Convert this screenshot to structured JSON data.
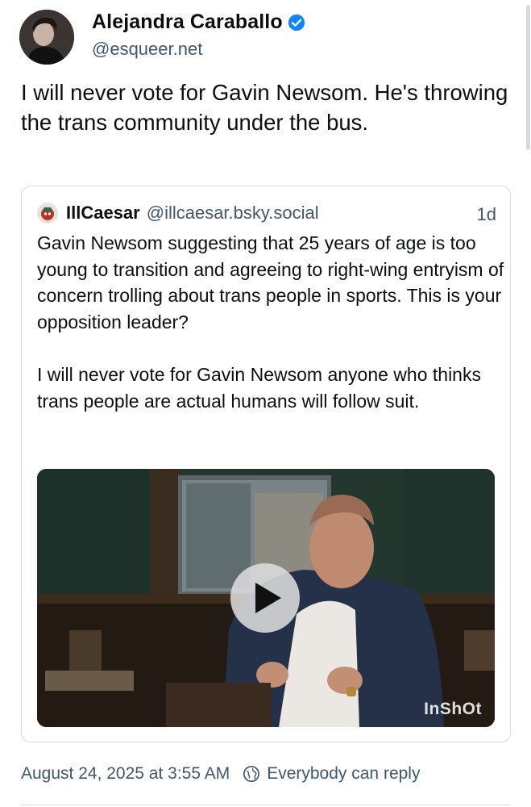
{
  "author": {
    "name": "Alejandra Caraballo",
    "handle": "@esqueer.net",
    "verified_icon": "verified-badge-icon"
  },
  "post": {
    "text": "I will never vote for Gavin Newsom. He's throwing the trans community under the bus."
  },
  "quote": {
    "author_name": "IllCaesar",
    "author_handle": "@illcaesar.bsky.social",
    "time": "1d",
    "paragraphs": [
      "Gavin Newsom suggesting that 25 years of age is too young to transition and agreeing to right-wing entryism of concern trolling about trans people in sports. This is your opposition leader?",
      "I will never vote for Gavin Newsom anyone who thinks trans people are actual humans will follow suit."
    ],
    "video": {
      "watermark": "InShOt",
      "play_icon": "play-icon"
    }
  },
  "footer": {
    "timestamp": "August 24, 2025 at 3:55 AM",
    "reply_setting": "Everybody can reply",
    "reply_icon": "globe-icon"
  },
  "colors": {
    "accent": "#1083fe",
    "secondary_text": "#42576c",
    "border": "#d4dbe2"
  }
}
